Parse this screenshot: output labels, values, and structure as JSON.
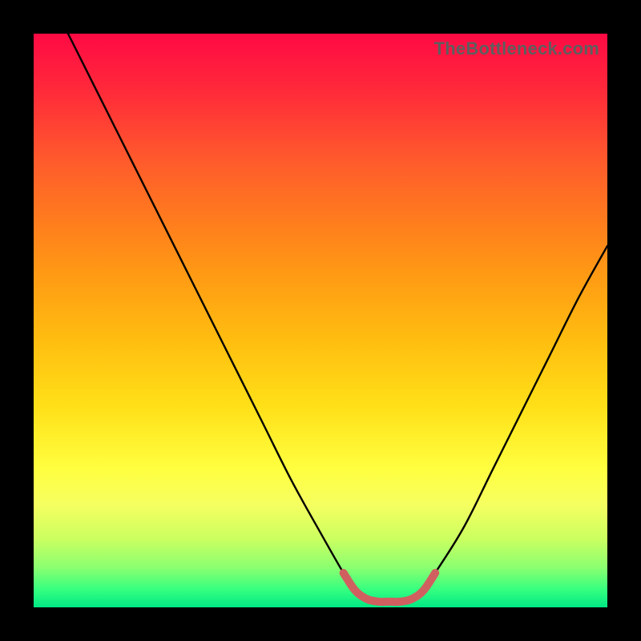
{
  "watermark": "TheBottleneck.com",
  "chart_data": {
    "type": "line",
    "title": "",
    "xlabel": "",
    "ylabel": "",
    "xlim": [
      0,
      100
    ],
    "ylim": [
      0,
      100
    ],
    "grid": false,
    "legend": null,
    "series": [
      {
        "name": "bottleneck-curve",
        "color": "#000000",
        "x": [
          6,
          10,
          15,
          20,
          25,
          30,
          35,
          40,
          45,
          50,
          54,
          56,
          58,
          60,
          62,
          64,
          66,
          68,
          70,
          75,
          80,
          85,
          90,
          95,
          100
        ],
        "values": [
          100,
          92,
          82,
          72,
          62,
          52,
          42,
          32,
          22,
          13,
          6,
          3,
          1.5,
          1,
          1,
          1,
          1.5,
          3,
          6,
          14,
          24,
          34,
          44,
          54,
          63
        ]
      },
      {
        "name": "bottom-highlight",
        "color": "#d06060",
        "x": [
          54,
          56,
          58,
          60,
          62,
          64,
          66,
          68,
          70
        ],
        "values": [
          6,
          3,
          1.5,
          1,
          1,
          1,
          1.5,
          3,
          6
        ]
      }
    ],
    "annotations": []
  }
}
